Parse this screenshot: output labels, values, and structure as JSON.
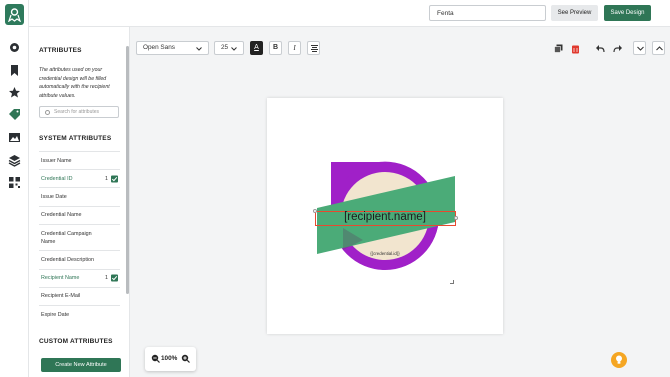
{
  "topbar": {
    "design_name": "Fenta",
    "preview_label": "See Preview",
    "save_label": "Save Design"
  },
  "rail": {
    "icons": [
      "logo-icon",
      "settings-gear-icon",
      "bookmark-icon",
      "star-icon",
      "tag-icon",
      "image-icon",
      "layers-icon",
      "qr-grid-icon"
    ]
  },
  "sidebar": {
    "attributes_title": "ATTRIBUTES",
    "attributes_desc": "The attributes used on your credential design will be filled automatically with the recipient attribute values.",
    "search_placeholder": "Search for attributes",
    "system_title": "SYSTEM ATTRIBUTES",
    "items": [
      {
        "label": "Issuer Name",
        "selected": false,
        "count": ""
      },
      {
        "label": "Credential ID",
        "selected": true,
        "count": "1"
      },
      {
        "label": "Issue Date",
        "selected": false,
        "count": ""
      },
      {
        "label": "Credential Name",
        "selected": false,
        "count": ""
      },
      {
        "label": "Credential Campaign Name",
        "selected": false,
        "count": ""
      },
      {
        "label": "Credential Description",
        "selected": false,
        "count": ""
      },
      {
        "label": "Recipient Name",
        "selected": true,
        "count": "1"
      },
      {
        "label": "Recipient E-Mail",
        "selected": false,
        "count": ""
      },
      {
        "label": "Expire Date",
        "selected": false,
        "count": ""
      }
    ],
    "custom_title": "CUSTOM ATTRIBUTES",
    "create_label": "Create New Attribute"
  },
  "toolbar": {
    "font_family": "Open Sans",
    "font_size": "25",
    "text_color_glyph": "A",
    "bold_glyph": "B",
    "italic_glyph": "I"
  },
  "canvas": {
    "recipient_placeholder": "[recipient.name]",
    "credential_placeholder": "{{credential.id}}"
  },
  "zoom": {
    "value": "100%"
  },
  "colors": {
    "accent": "#2f7656",
    "badge_purple": "#a020c8",
    "badge_cream": "#f2e5cf",
    "ribbon_green": "#4bab78",
    "selection": "#e8492f",
    "help": "#f5a623"
  }
}
